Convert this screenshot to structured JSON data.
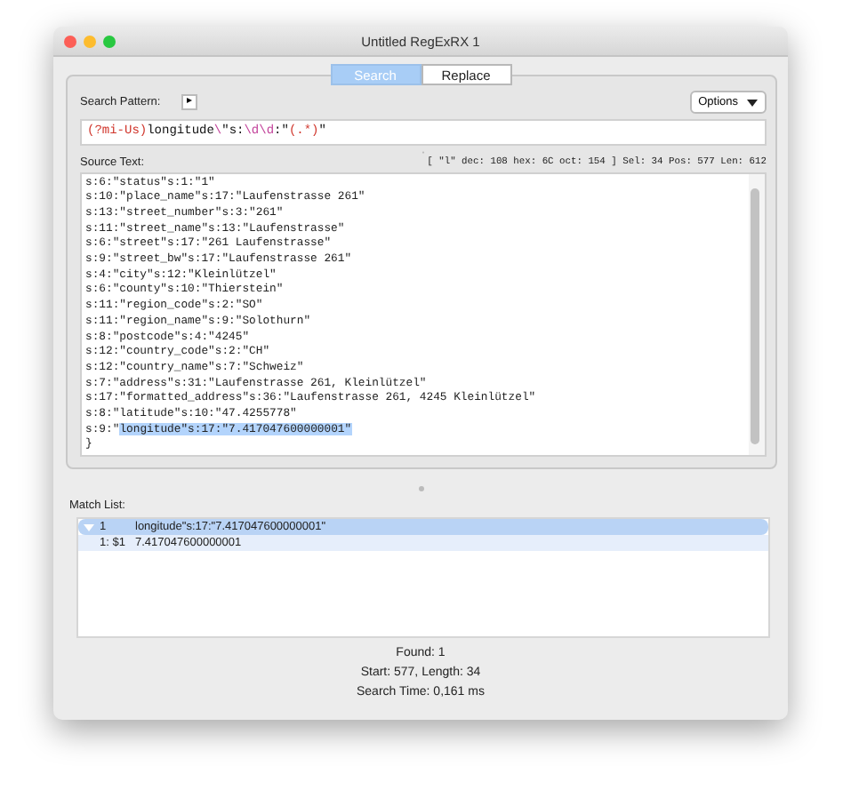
{
  "window": {
    "title": "Untitled RegExRX 1"
  },
  "tabs": [
    {
      "label": "Search",
      "selected": true
    },
    {
      "label": "Replace",
      "selected": false
    }
  ],
  "search_pattern": {
    "label": "Search Pattern:",
    "arrow": "▸",
    "options": "Options",
    "segments": [
      {
        "text": "(?mi-Us)",
        "kind": "group"
      },
      {
        "text": "longitude",
        "kind": "literal"
      },
      {
        "text": "\\",
        "kind": "escape"
      },
      {
        "text": "\"s:",
        "kind": "literal"
      },
      {
        "text": "\\d\\d",
        "kind": "class"
      },
      {
        "text": ":\"",
        "kind": "literal"
      },
      {
        "text": "(.*)",
        "kind": "group"
      },
      {
        "text": "\"",
        "kind": "literal"
      }
    ]
  },
  "source_text": {
    "label": "Source Text:",
    "info": "[ \"l\" dec: 108 hex: 6C oct: 154 ] Sel: 34 Pos: 577 Len: 612",
    "lines": [
      {
        "text": "s:6:\"status\"s:1:\"1\""
      },
      {
        "text": "s:10:\"place_name\"s:17:\"Laufenstrasse 261\""
      },
      {
        "text": "s:13:\"street_number\"s:3:\"261\""
      },
      {
        "text": "s:11:\"street_name\"s:13:\"Laufenstrasse\""
      },
      {
        "text": "s:6:\"street\"s:17:\"261 Laufenstrasse\""
      },
      {
        "text": "s:9:\"street_bw\"s:17:\"Laufenstrasse 261\""
      },
      {
        "text": "s:4:\"city\"s:12:\"Kleinlützel\""
      },
      {
        "text": "s:6:\"county\"s:10:\"Thierstein\""
      },
      {
        "text": "s:11:\"region_code\"s:2:\"SO\""
      },
      {
        "text": "s:11:\"region_name\"s:9:\"Solothurn\""
      },
      {
        "text": "s:8:\"postcode\"s:4:\"4245\""
      },
      {
        "text": "s:12:\"country_code\"s:2:\"CH\""
      },
      {
        "text": "s:12:\"country_name\"s:7:\"Schweiz\""
      },
      {
        "text": "s:7:\"address\"s:31:\"Laufenstrasse 261, Kleinlützel\""
      },
      {
        "text": "s:17:\"formatted_address\"s:36:\"Laufenstrasse 261, 4245 Kleinlützel\""
      },
      {
        "text": "s:8:\"latitude\"s:10:\"47.4255778\""
      },
      {
        "text": "s:9:\"",
        "selected_text": "longitude\"s:17:\"7.417047600000001\""
      },
      {
        "text": "}"
      }
    ]
  },
  "match_list": {
    "label": "Match List:",
    "rows": [
      {
        "index": "1",
        "text": "longitude\"s:17:\"7.417047600000001\"",
        "expanded": true,
        "selected": true
      },
      {
        "index": "1: $1",
        "text": "7.417047600000001",
        "selected": false
      }
    ]
  },
  "status": [
    "Found: 1",
    "Start: 577, Length: 34",
    "Search Time: 0,161 ms"
  ]
}
